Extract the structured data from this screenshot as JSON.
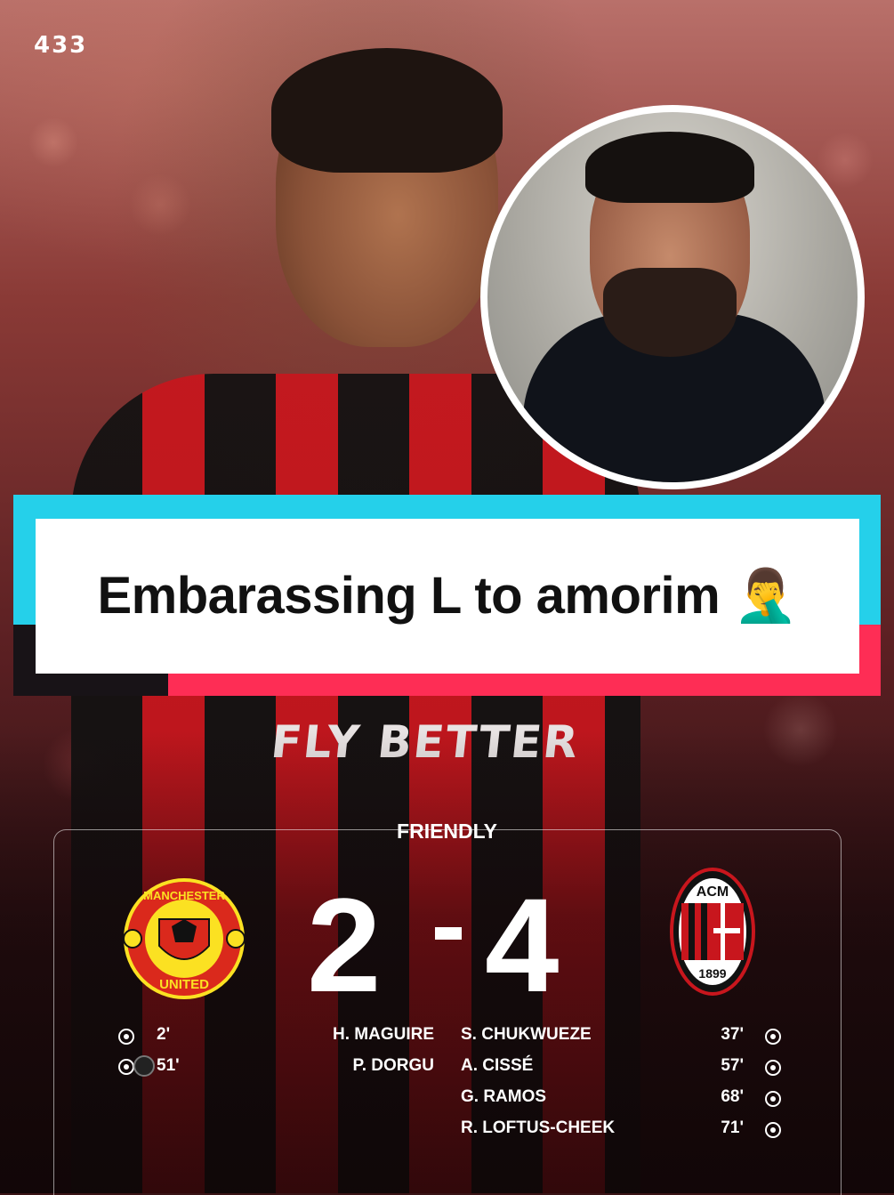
{
  "brand": {
    "logo_text": "433"
  },
  "caption": {
    "text": "Embarassing L to amorim 🤦‍♂️"
  },
  "photo": {
    "shirt_slogan": "FLY BETTER"
  },
  "match": {
    "competition": "FRIENDLY",
    "home": {
      "name": "MANCHESTER UNITED",
      "crest_top": "MANCHESTER",
      "crest_bottom": "UNITED",
      "score": "2"
    },
    "away": {
      "name": "AC MILAN",
      "crest_top": "ACM",
      "crest_year": "1899",
      "score": "4"
    },
    "separator": "-",
    "home_goals": [
      {
        "minute": "2'",
        "player": "H. MAGUIRE"
      },
      {
        "minute": "51'",
        "player": "P. DORGU"
      }
    ],
    "away_goals": [
      {
        "player": "S. CHUKWUEZE",
        "minute": "37'"
      },
      {
        "player": "A. CISSÉ",
        "minute": "57'"
      },
      {
        "player": "G. RAMOS",
        "minute": "68'"
      },
      {
        "player": "R. LOFTUS-CHEEK",
        "minute": "71'"
      }
    ]
  },
  "colors": {
    "banner_cyan": "#25d0ea",
    "banner_red": "#fe2d55",
    "milan_red": "#c8161d",
    "united_red": "#da291c",
    "united_gold": "#fbe122"
  }
}
